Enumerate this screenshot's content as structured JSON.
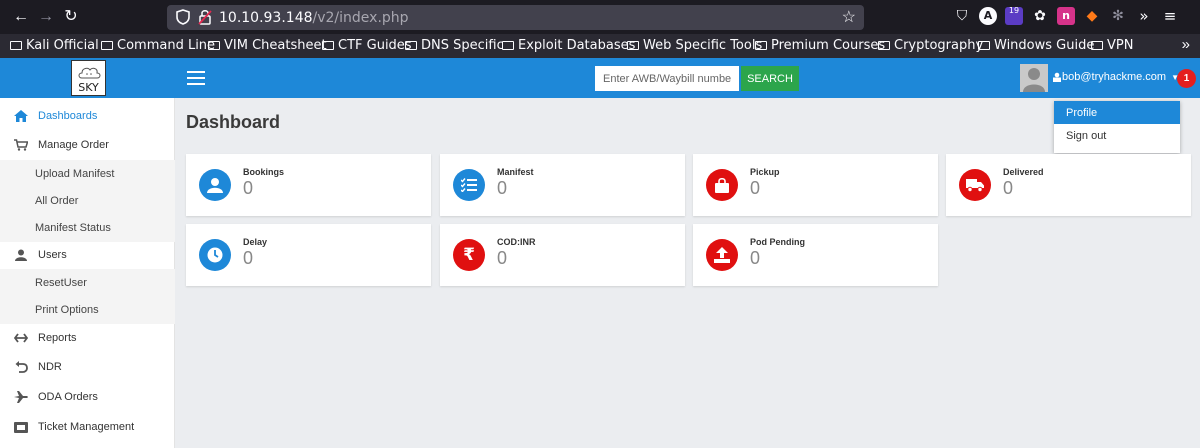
{
  "browser": {
    "url_host": "10.10.93.148",
    "url_path": "/v2/index.php",
    "extension_badge": "19",
    "bookmarks": [
      "Kali Official",
      "Command Line",
      "VIM Cheatsheet",
      "CTF Guides",
      "DNS Specific",
      "Exploit Databases",
      "Web Specific Tools",
      "Premium Courses",
      "Cryptography",
      "Windows Guide",
      "VPN"
    ]
  },
  "header": {
    "logo_text": "SKY",
    "search_placeholder": "Enter AWB/Waybill number",
    "search_button": "SEARCH",
    "user_email": "bob@tryhackme.com",
    "notification_count": "1",
    "colors": {
      "primary": "#1e88d8",
      "search": "#2ca54b",
      "badge": "#e41e1e"
    }
  },
  "dropdown": {
    "items": [
      "Profile",
      "Sign out"
    ],
    "active": "Profile"
  },
  "sidebar": {
    "items": [
      {
        "label": "Dashboards",
        "icon": "home-icon"
      },
      {
        "label": "Manage Order",
        "icon": "cart-icon"
      },
      {
        "label": "Upload Manifest"
      },
      {
        "label": "All Order"
      },
      {
        "label": "Manifest Status"
      },
      {
        "label": "Users",
        "icon": "user-icon"
      },
      {
        "label": "ResetUser"
      },
      {
        "label": "Print Options"
      },
      {
        "label": "Reports",
        "icon": "reports-icon"
      },
      {
        "label": "NDR",
        "icon": "undo-icon"
      },
      {
        "label": "ODA Orders",
        "icon": "plane-icon"
      },
      {
        "label": "Ticket Management",
        "icon": "ticket-icon"
      }
    ]
  },
  "main": {
    "title": "Dashboard",
    "cards": [
      {
        "title": "Bookings",
        "value": "0",
        "color": "#1e88d8",
        "icon": "user-icon"
      },
      {
        "title": "Manifest",
        "value": "0",
        "color": "#1e88d8",
        "icon": "list-icon"
      },
      {
        "title": "Pickup",
        "value": "0",
        "color": "#e01010",
        "icon": "bag-icon"
      },
      {
        "title": "Delivered",
        "value": "0",
        "color": "#e01010",
        "icon": "truck-icon"
      },
      {
        "title": "Delay",
        "value": "0",
        "color": "#1e88d8",
        "icon": "clock-icon"
      },
      {
        "title": "COD:INR",
        "value": "0",
        "color": "#e01010",
        "icon": "rupee-icon"
      },
      {
        "title": "Pod Pending",
        "value": "0",
        "color": "#e01010",
        "icon": "upload-icon"
      }
    ]
  }
}
